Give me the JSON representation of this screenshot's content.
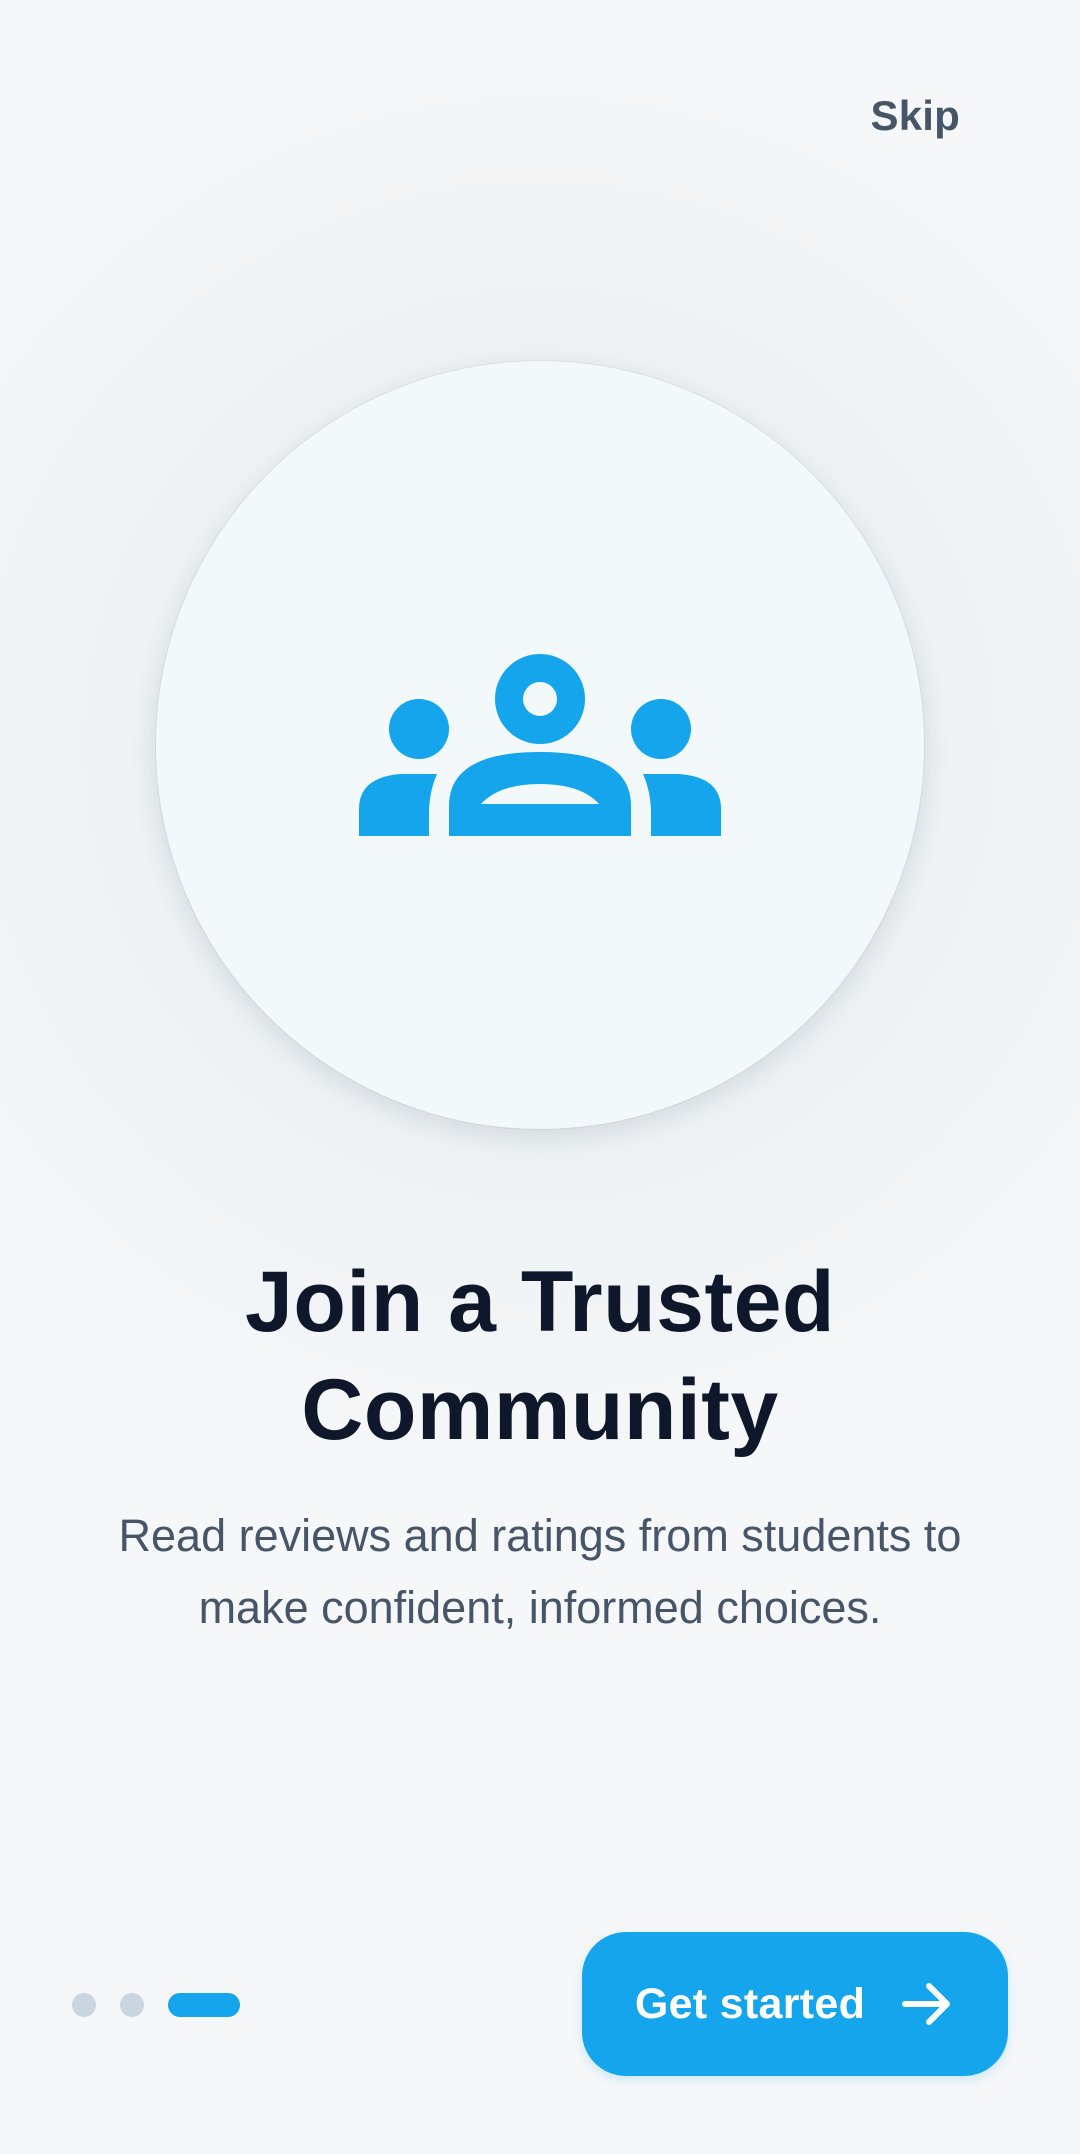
{
  "header": {
    "skip_label": "Skip"
  },
  "hero": {
    "icon": "community-group-icon",
    "icon_color": "#14a5ec"
  },
  "content": {
    "title_line1": "Join a Trusted",
    "title_line2": "Community",
    "subtitle_line1": "Read reviews and ratings from students to",
    "subtitle_line2": "make confident, informed choices."
  },
  "pagination": {
    "total_pages": 3,
    "current_page": 3,
    "active_color": "#14a5ec",
    "inactive_color": "#cbd5e1"
  },
  "cta": {
    "label": "Get started",
    "icon": "arrow-right-icon",
    "color": "#14a5ec"
  }
}
